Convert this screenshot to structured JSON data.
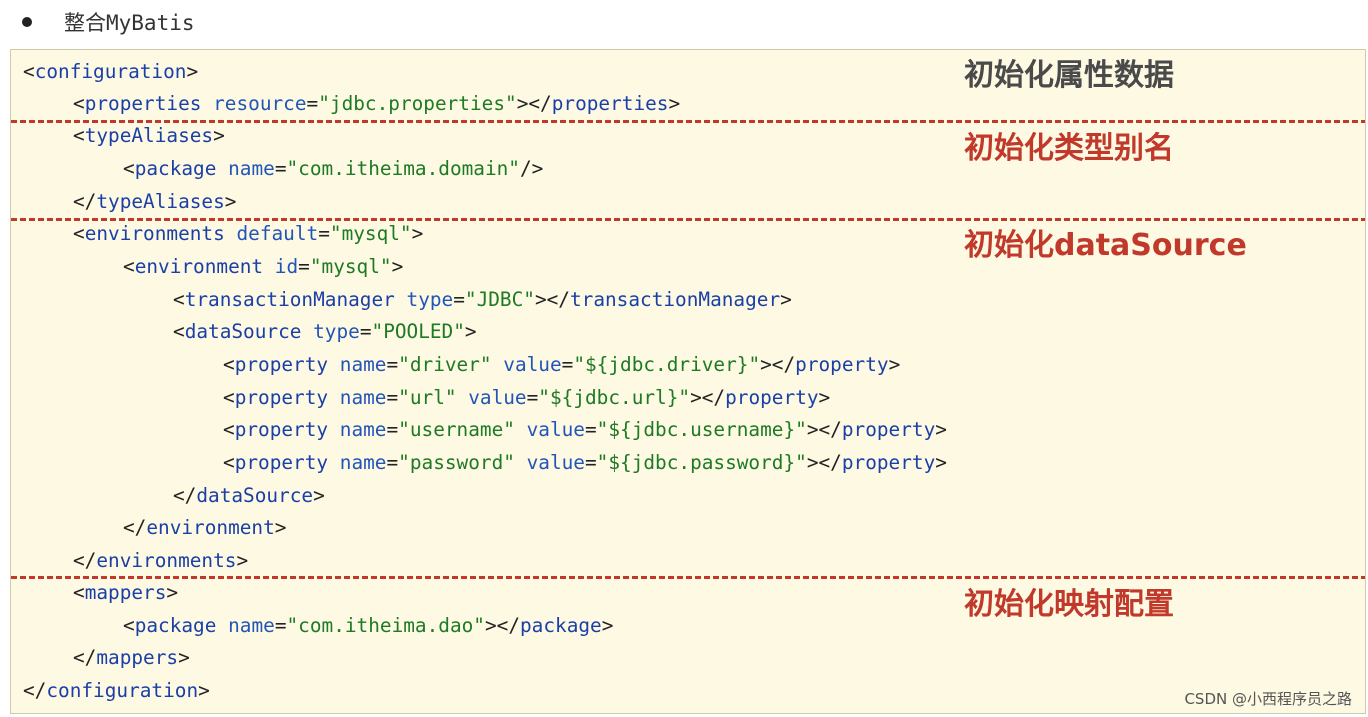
{
  "heading": {
    "bullet": "●",
    "text": "整合MyBatis"
  },
  "colors": {
    "box_bg": "#fdf9e3",
    "tag": "#1a3fa6",
    "attr": "#2255b8",
    "value": "#1e7a24",
    "divider": "#c0392b",
    "label_gray": "#4a4a4a",
    "label_red": "#c0392b"
  },
  "section_labels": [
    "初始化属性数据",
    "初始化类型别名",
    "初始化dataSource",
    "初始化映射配置"
  ],
  "code_lines": [
    [
      [
        "p",
        "<"
      ],
      [
        "t",
        "configuration"
      ],
      [
        "p",
        ">"
      ]
    ],
    [
      [
        "p",
        "<"
      ],
      [
        "t",
        "properties"
      ],
      [
        "p",
        " "
      ],
      [
        "a",
        "resource"
      ],
      [
        "p",
        "="
      ],
      [
        "v",
        "\"jdbc.properties\""
      ],
      [
        "p",
        "></"
      ],
      [
        "t",
        "properties"
      ],
      [
        "p",
        ">"
      ]
    ],
    [
      [
        "p",
        "<"
      ],
      [
        "t",
        "typeAliases"
      ],
      [
        "p",
        ">"
      ]
    ],
    [
      [
        "p",
        "<"
      ],
      [
        "t",
        "package"
      ],
      [
        "p",
        " "
      ],
      [
        "a",
        "name"
      ],
      [
        "p",
        "="
      ],
      [
        "v",
        "\"com.itheima.domain\""
      ],
      [
        "p",
        "/>"
      ]
    ],
    [
      [
        "p",
        "</"
      ],
      [
        "t",
        "typeAliases"
      ],
      [
        "p",
        ">"
      ]
    ],
    [
      [
        "p",
        "<"
      ],
      [
        "t",
        "environments"
      ],
      [
        "p",
        " "
      ],
      [
        "a",
        "default"
      ],
      [
        "p",
        "="
      ],
      [
        "v",
        "\"mysql\""
      ],
      [
        "p",
        ">"
      ]
    ],
    [
      [
        "p",
        "<"
      ],
      [
        "t",
        "environment"
      ],
      [
        "p",
        " "
      ],
      [
        "a",
        "id"
      ],
      [
        "p",
        "="
      ],
      [
        "v",
        "\"mysql\""
      ],
      [
        "p",
        ">"
      ]
    ],
    [
      [
        "p",
        "<"
      ],
      [
        "t",
        "transactionManager"
      ],
      [
        "p",
        " "
      ],
      [
        "a",
        "type"
      ],
      [
        "p",
        "="
      ],
      [
        "v",
        "\"JDBC\""
      ],
      [
        "p",
        "></"
      ],
      [
        "t",
        "transactionManager"
      ],
      [
        "p",
        ">"
      ]
    ],
    [
      [
        "p",
        "<"
      ],
      [
        "t",
        "dataSource"
      ],
      [
        "p",
        " "
      ],
      [
        "a",
        "type"
      ],
      [
        "p",
        "="
      ],
      [
        "v",
        "\"POOLED\""
      ],
      [
        "p",
        ">"
      ]
    ],
    [
      [
        "p",
        "<"
      ],
      [
        "t",
        "property"
      ],
      [
        "p",
        " "
      ],
      [
        "a",
        "name"
      ],
      [
        "p",
        "="
      ],
      [
        "v",
        "\"driver\""
      ],
      [
        "p",
        " "
      ],
      [
        "a",
        "value"
      ],
      [
        "p",
        "="
      ],
      [
        "v",
        "\"${jdbc.driver}\""
      ],
      [
        "p",
        "></"
      ],
      [
        "t",
        "property"
      ],
      [
        "p",
        ">"
      ]
    ],
    [
      [
        "p",
        "<"
      ],
      [
        "t",
        "property"
      ],
      [
        "p",
        " "
      ],
      [
        "a",
        "name"
      ],
      [
        "p",
        "="
      ],
      [
        "v",
        "\"url\""
      ],
      [
        "p",
        " "
      ],
      [
        "a",
        "value"
      ],
      [
        "p",
        "="
      ],
      [
        "v",
        "\"${jdbc.url}\""
      ],
      [
        "p",
        "></"
      ],
      [
        "t",
        "property"
      ],
      [
        "p",
        ">"
      ]
    ],
    [
      [
        "p",
        "<"
      ],
      [
        "t",
        "property"
      ],
      [
        "p",
        " "
      ],
      [
        "a",
        "name"
      ],
      [
        "p",
        "="
      ],
      [
        "v",
        "\"username\""
      ],
      [
        "p",
        " "
      ],
      [
        "a",
        "value"
      ],
      [
        "p",
        "="
      ],
      [
        "v",
        "\"${jdbc.username}\""
      ],
      [
        "p",
        "></"
      ],
      [
        "t",
        "property"
      ],
      [
        "p",
        ">"
      ]
    ],
    [
      [
        "p",
        "<"
      ],
      [
        "t",
        "property"
      ],
      [
        "p",
        " "
      ],
      [
        "a",
        "name"
      ],
      [
        "p",
        "="
      ],
      [
        "v",
        "\"password\""
      ],
      [
        "p",
        " "
      ],
      [
        "a",
        "value"
      ],
      [
        "p",
        "="
      ],
      [
        "v",
        "\"${jdbc.password}\""
      ],
      [
        "p",
        "></"
      ],
      [
        "t",
        "property"
      ],
      [
        "p",
        ">"
      ]
    ],
    [
      [
        "p",
        "</"
      ],
      [
        "t",
        "dataSource"
      ],
      [
        "p",
        ">"
      ]
    ],
    [
      [
        "p",
        "</"
      ],
      [
        "t",
        "environment"
      ],
      [
        "p",
        ">"
      ]
    ],
    [
      [
        "p",
        "</"
      ],
      [
        "t",
        "environments"
      ],
      [
        "p",
        ">"
      ]
    ],
    [
      [
        "p",
        "<"
      ],
      [
        "t",
        "mappers"
      ],
      [
        "p",
        ">"
      ]
    ],
    [
      [
        "p",
        "<"
      ],
      [
        "t",
        "package"
      ],
      [
        "p",
        " "
      ],
      [
        "a",
        "name"
      ],
      [
        "p",
        "="
      ],
      [
        "v",
        "\"com.itheima.dao\""
      ],
      [
        "p",
        "></"
      ],
      [
        "t",
        "package"
      ],
      [
        "p",
        ">"
      ]
    ],
    [
      [
        "p",
        "</"
      ],
      [
        "t",
        "mappers"
      ],
      [
        "p",
        ">"
      ]
    ],
    [
      [
        "p",
        "</"
      ],
      [
        "t",
        "configuration"
      ],
      [
        "p",
        ">"
      ]
    ]
  ],
  "watermark": "CSDN @小西程序员之路"
}
